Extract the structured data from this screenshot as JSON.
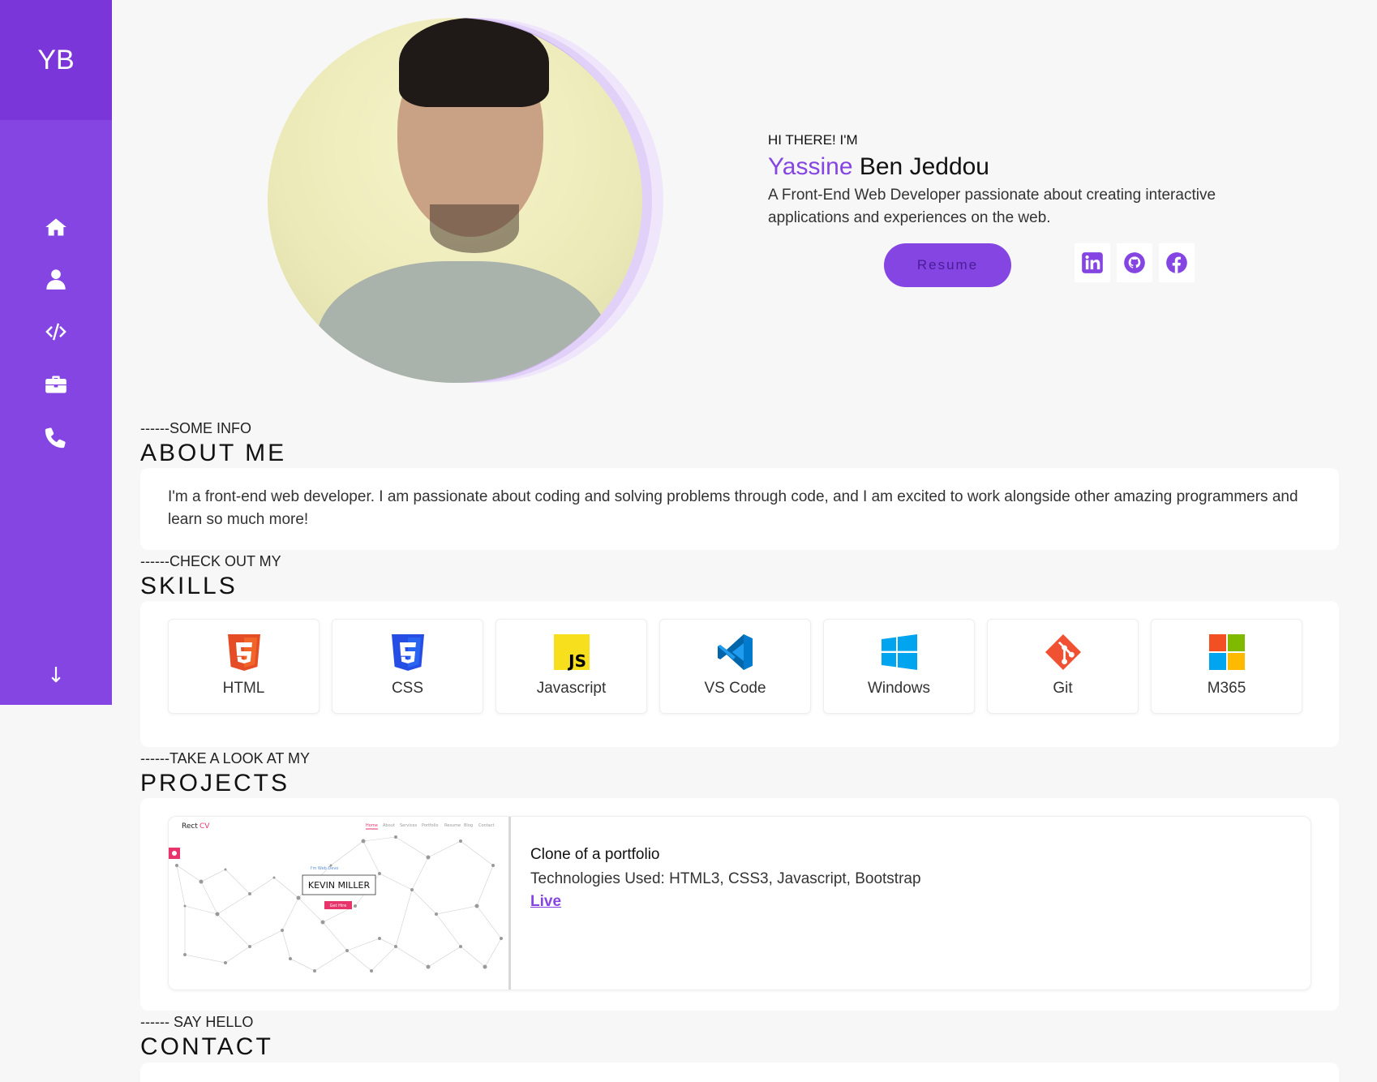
{
  "brand": {
    "initials": "YB",
    "accent": "#8545e2"
  },
  "sidebar": {
    "items": [
      {
        "label": "home",
        "icon": "home-icon"
      },
      {
        "label": "about",
        "icon": "user-icon"
      },
      {
        "label": "skills",
        "icon": "code-icon"
      },
      {
        "label": "projects",
        "icon": "briefcase-icon"
      },
      {
        "label": "contact",
        "icon": "phone-icon"
      }
    ],
    "scroll_glyph": "↓"
  },
  "hero": {
    "greeting": "HI THERE! I'M",
    "first_name": "Yassine",
    "last_name": "Ben Jeddou",
    "tagline": "A Front-End Web Developer passionate about creating interactive applications and experiences on the web.",
    "resume_label": "Resume",
    "socials": [
      "linkedin-icon",
      "github-icon",
      "facebook-icon"
    ]
  },
  "about": {
    "kicker": "------SOME INFO",
    "title": "ABOUT ME",
    "text": "I'm a front-end web developer. I am passionate about coding and solving problems through code, and I am excited to work alongside other amazing programmers and learn so much more!"
  },
  "skills": {
    "kicker": "------CHECK OUT MY",
    "title": "SKILLS",
    "items": [
      {
        "label": "HTML",
        "icon": "html5-icon"
      },
      {
        "label": "CSS",
        "icon": "css3-icon"
      },
      {
        "label": "Javascript",
        "icon": "javascript-icon"
      },
      {
        "label": "VS Code",
        "icon": "vscode-icon"
      },
      {
        "label": "Windows",
        "icon": "windows-icon"
      },
      {
        "label": "Git",
        "icon": "git-icon"
      },
      {
        "label": "M365",
        "icon": "microsoft-icon"
      }
    ]
  },
  "projects": {
    "kicker": "------TAKE A LOOK AT MY",
    "title": "PROJECTS",
    "items": [
      {
        "title": "Clone of a portfolio",
        "tech": "Technologies Used: HTML3, CSS3, Javascript, Bootstrap",
        "live_label": "Live",
        "thumb": {
          "brand_a": "Rect",
          "brand_b": "CV",
          "nav": [
            "Home",
            "About",
            "Services",
            "Portfolio",
            "Resume",
            "Blog",
            "Contact"
          ],
          "subtitle": "I'm Web Devo",
          "name": "KEVIN MILLER",
          "button": "Get Hire"
        }
      }
    ]
  },
  "contact": {
    "kicker": "------ SAY HELLO",
    "title": "CONTACT"
  }
}
